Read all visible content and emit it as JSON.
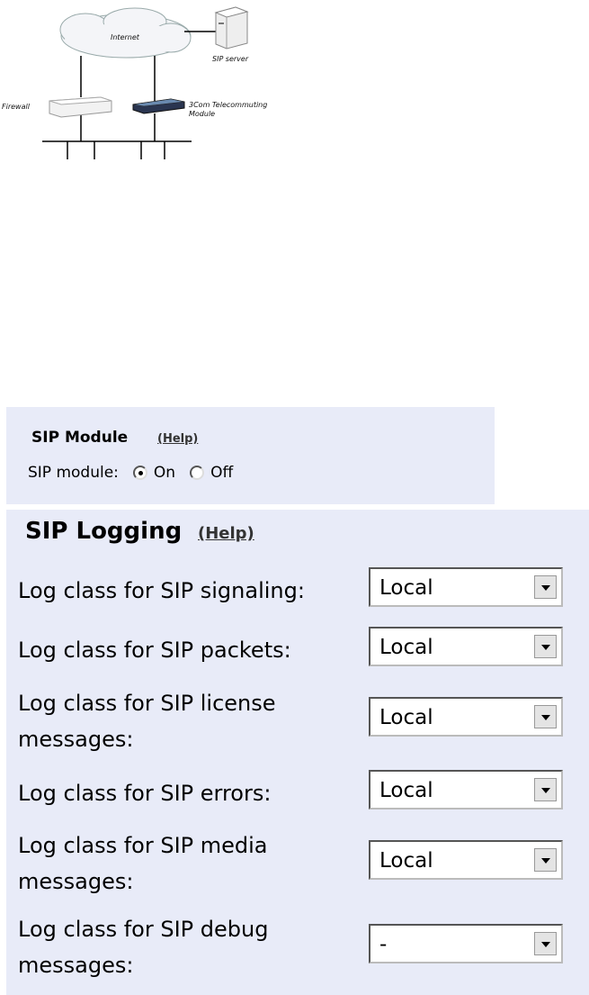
{
  "diagram": {
    "internet_label": "Internet",
    "sip_server_label": "SIP server",
    "firewall_label": "Firewall",
    "module_label_line1": "3Com Telecommuting",
    "module_label_line2": "Module"
  },
  "sip_module": {
    "title": "SIP Module",
    "help_link": "(Help)",
    "field_label": "SIP module:",
    "options": [
      {
        "label": "On",
        "checked": true
      },
      {
        "label": "Off",
        "checked": false
      }
    ]
  },
  "sip_logging": {
    "title": "SIP Logging",
    "help_link": "(Help)",
    "rows": [
      {
        "label_line1": "Log class for SIP signaling:",
        "label_line2": "",
        "value": "Local"
      },
      {
        "label_line1": "Log class for SIP packets:",
        "label_line2": "",
        "value": "Local"
      },
      {
        "label_line1": "Log class for SIP license",
        "label_line2": "messages:",
        "value": "Local"
      },
      {
        "label_line1": "Log class for SIP errors:",
        "label_line2": "",
        "value": "Local"
      },
      {
        "label_line1": "Log class for SIP media",
        "label_line2": "messages:",
        "value": "Local"
      },
      {
        "label_line1": "Log class for SIP debug",
        "label_line2": "messages:",
        "value": "-"
      }
    ]
  },
  "icons": {
    "cloud": "cloud-icon",
    "server": "server-icon",
    "firewall": "firewall-icon",
    "module": "telecommuting-module-icon"
  }
}
